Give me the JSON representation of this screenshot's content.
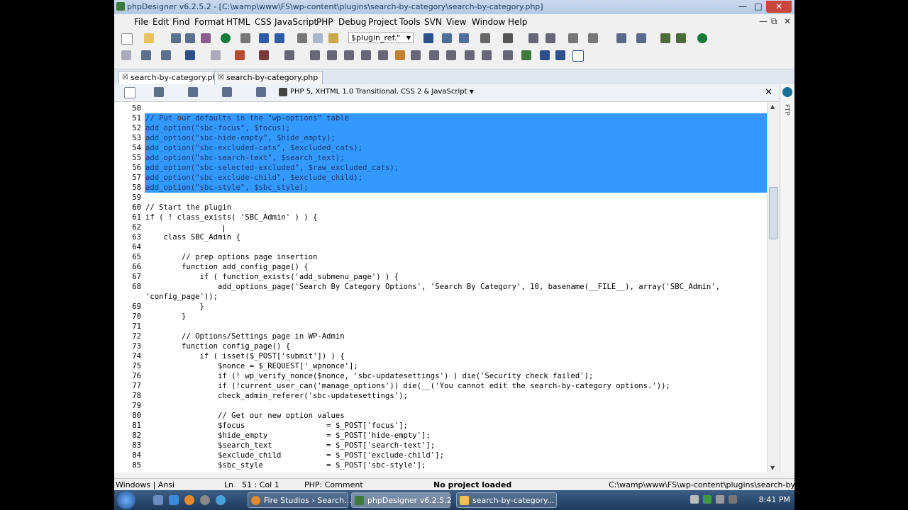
{
  "window": {
    "title": "phpDesigner v6.2.5.2 - [C:\\wamp\\www\\FS\\wp-content\\plugins\\search-by-category\\search-by-category.php]"
  },
  "menu": [
    "File",
    "Edit",
    "Find",
    "Format",
    "HTML",
    "CSS",
    "JavaScript",
    "PHP",
    "Debug",
    "Project",
    "Tools",
    "SVN",
    "View",
    "Window",
    "Help"
  ],
  "toolbar": {
    "function_combo": "$plugin_ref.\""
  },
  "tabs": [
    {
      "label": "search-by-category.php",
      "active": true
    },
    {
      "label": "search-by-category.php",
      "active": false
    }
  ],
  "editor_toolbar": {
    "doctype": "PHP 5, XHTML 1.0 Transitional, CSS 2 & JavaScript"
  },
  "right_pane": {
    "label": "FTP"
  },
  "code_lines": [
    {
      "n": "50",
      "t": "",
      "sel": false
    },
    {
      "n": "51",
      "t": "// Put our defaults in the \"wp-options\" table",
      "sel": true
    },
    {
      "n": "52",
      "t": "add_option(\"sbc-focus\", $focus);",
      "sel": true
    },
    {
      "n": "53",
      "t": "add_option(\"sbc-hide-empty\", $hide_empty);",
      "sel": true
    },
    {
      "n": "54",
      "t": "add_option(\"sbc-excluded-cats\", $excluded_cats);",
      "sel": true
    },
    {
      "n": "55",
      "t": "add_option(\"sbc-search-text\", $search_text);",
      "sel": true
    },
    {
      "n": "56",
      "t": "add_option(\"sbc-selected-excluded\", $raw_excluded_cats);",
      "sel": true
    },
    {
      "n": "57",
      "t": "add_option(\"sbc-exclude-child\", $exclude_child);",
      "sel": true
    },
    {
      "n": "58",
      "t": "add_option(\"sbc-style\", $sbc_style);",
      "sel": true
    },
    {
      "n": "59",
      "t": "",
      "sel": false
    },
    {
      "n": "60",
      "t": "// Start the plugin",
      "sel": false
    },
    {
      "n": "61",
      "t": "if ( ! class_exists( 'SBC_Admin' ) ) {",
      "sel": false
    },
    {
      "n": "62",
      "t": "",
      "sel": false
    },
    {
      "n": "63",
      "t": "    class SBC_Admin {",
      "sel": false
    },
    {
      "n": "64",
      "t": "",
      "sel": false
    },
    {
      "n": "65",
      "t": "        // prep options page insertion",
      "sel": false
    },
    {
      "n": "66",
      "t": "        function add_config_page() {",
      "sel": false
    },
    {
      "n": "67",
      "t": "            if ( function_exists('add_submenu_page') ) {",
      "sel": false
    },
    {
      "n": "68",
      "t": "                add_options_page('Search By Category Options', 'Search By Category', 10, basename(__FILE__), array('SBC_Admin',",
      "sel": false
    },
    {
      "n": "",
      "t": "'config_page'));",
      "sel": false
    },
    {
      "n": "69",
      "t": "            }",
      "sel": false
    },
    {
      "n": "70",
      "t": "        }",
      "sel": false
    },
    {
      "n": "71",
      "t": "",
      "sel": false
    },
    {
      "n": "72",
      "t": "        // Options/Settings page in WP-Admin",
      "sel": false
    },
    {
      "n": "73",
      "t": "        function config_page() {",
      "sel": false
    },
    {
      "n": "74",
      "t": "            if ( isset($_POST['submit']) ) {",
      "sel": false
    },
    {
      "n": "75",
      "t": "                $nonce = $_REQUEST['_wpnonce'];",
      "sel": false
    },
    {
      "n": "76",
      "t": "                if (! wp_verify_nonce($nonce, 'sbc-updatesettings') ) die('Security check failed');",
      "sel": false
    },
    {
      "n": "77",
      "t": "                if (!current_user_can('manage_options')) die(__('You cannot edit the search-by-category options.'));",
      "sel": false
    },
    {
      "n": "78",
      "t": "                check_admin_referer('sbc-updatesettings');",
      "sel": false
    },
    {
      "n": "79",
      "t": "",
      "sel": false
    },
    {
      "n": "80",
      "t": "                // Get our new option values",
      "sel": false
    },
    {
      "n": "81",
      "t": "                $focus                  = $_POST['focus'];",
      "sel": false
    },
    {
      "n": "82",
      "t": "                $hide_empty             = $_POST['hide-empty'];",
      "sel": false
    },
    {
      "n": "83",
      "t": "                $search_text            = $_POST['search-text'];",
      "sel": false
    },
    {
      "n": "84",
      "t": "                $exclude_child          = $_POST['exclude-child'];",
      "sel": false
    },
    {
      "n": "85",
      "t": "                $sbc_style              = $_POST['sbc-style'];",
      "sel": false
    }
  ],
  "status": {
    "linebreak": "Windows | Ansi",
    "ln_label": "Ln",
    "position": "51 : Col  1",
    "context": "PHP: Comment",
    "project": "No project loaded",
    "path": "C:\\wamp\\www\\FS\\wp-content\\plugins\\search-by-category"
  },
  "taskbar": {
    "items": [
      {
        "label": "Fire Studios › Search...",
        "active": false
      },
      {
        "label": "phpDesigner v6.2.5.2",
        "active": true
      },
      {
        "label": "search-by-category...",
        "active": false
      }
    ],
    "clock": "8:41 PM"
  },
  "colors": {
    "selection": "#3399ff",
    "titlebar": "#b3c9e4"
  }
}
